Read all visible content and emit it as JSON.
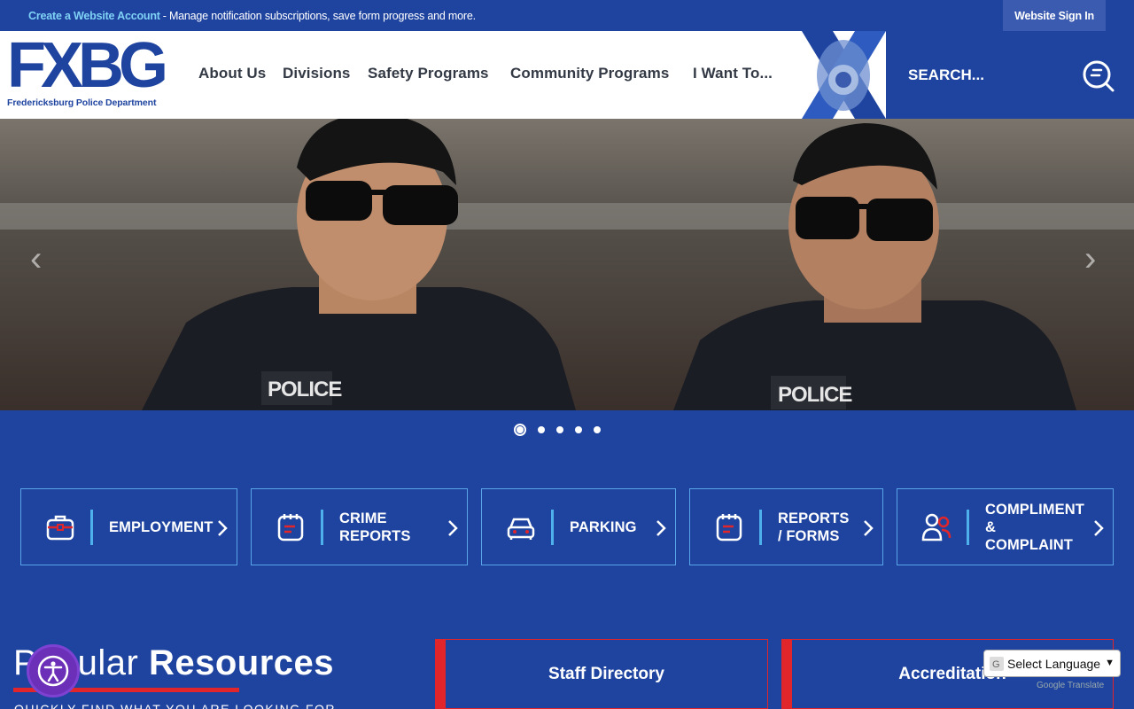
{
  "topbar": {
    "create_link": "Create a Website Account",
    "description": "- Manage notification subscriptions, save form progress and more.",
    "signin": "Website Sign In"
  },
  "header": {
    "logo_letters": "FXBG",
    "logo_subtitle": "Fredericksburg Police Department",
    "nav": [
      "About Us",
      "Divisions",
      "Safety Programs",
      "Community Programs",
      "I Want To..."
    ],
    "search_label": "SEARCH..."
  },
  "hero": {
    "badge_left": "POLICE",
    "badge_right": "POLICE",
    "slide_count": 5,
    "active_slide": 1
  },
  "quicklinks": [
    {
      "label": "EMPLOYMENT",
      "icon": "briefcase-icon"
    },
    {
      "label": "CRIME REPORTS",
      "icon": "notepad-icon"
    },
    {
      "label": "PARKING",
      "icon": "car-icon"
    },
    {
      "label": "REPORTS / FORMS",
      "icon": "notepad-icon"
    },
    {
      "label": "COMPLIMENT & COMPLAINT",
      "icon": "people-icon"
    }
  ],
  "popular": {
    "title_light": "Popular ",
    "title_bold": "Resources",
    "subtitle": "QUICKLY FIND WHAT YOU ARE LOOKING FOR"
  },
  "resources": [
    "Staff Directory",
    "Accreditation"
  ],
  "translate": {
    "select_label": "Select Language",
    "powered_by": "Google Translate"
  },
  "colors": {
    "brand_blue": "#1f44a0",
    "accent_red": "#e0262b",
    "tile_border": "#58a6e8",
    "link_cyan": "#7fd2f5"
  }
}
